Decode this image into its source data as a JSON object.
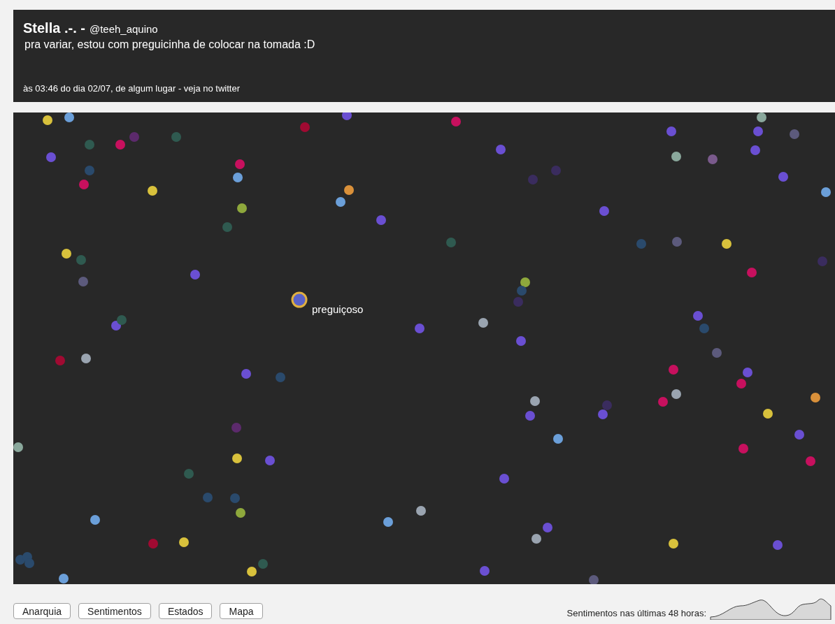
{
  "tweet": {
    "name": "Stella .-. -",
    "handle": "@teeh_aquino",
    "text": "pra variar, estou com preguicinha de colocar na tomada :D",
    "meta": "às 03:46 do dia 02/07, de algum lugar - veja no twitter"
  },
  "map": {
    "highlight_label": "preguiçoso"
  },
  "buttons": [
    "Anarquia",
    "Sentimentos",
    "Estados",
    "Mapa"
  ],
  "sparkline_label": "Sentimentos nas últimas 48 horas:"
}
